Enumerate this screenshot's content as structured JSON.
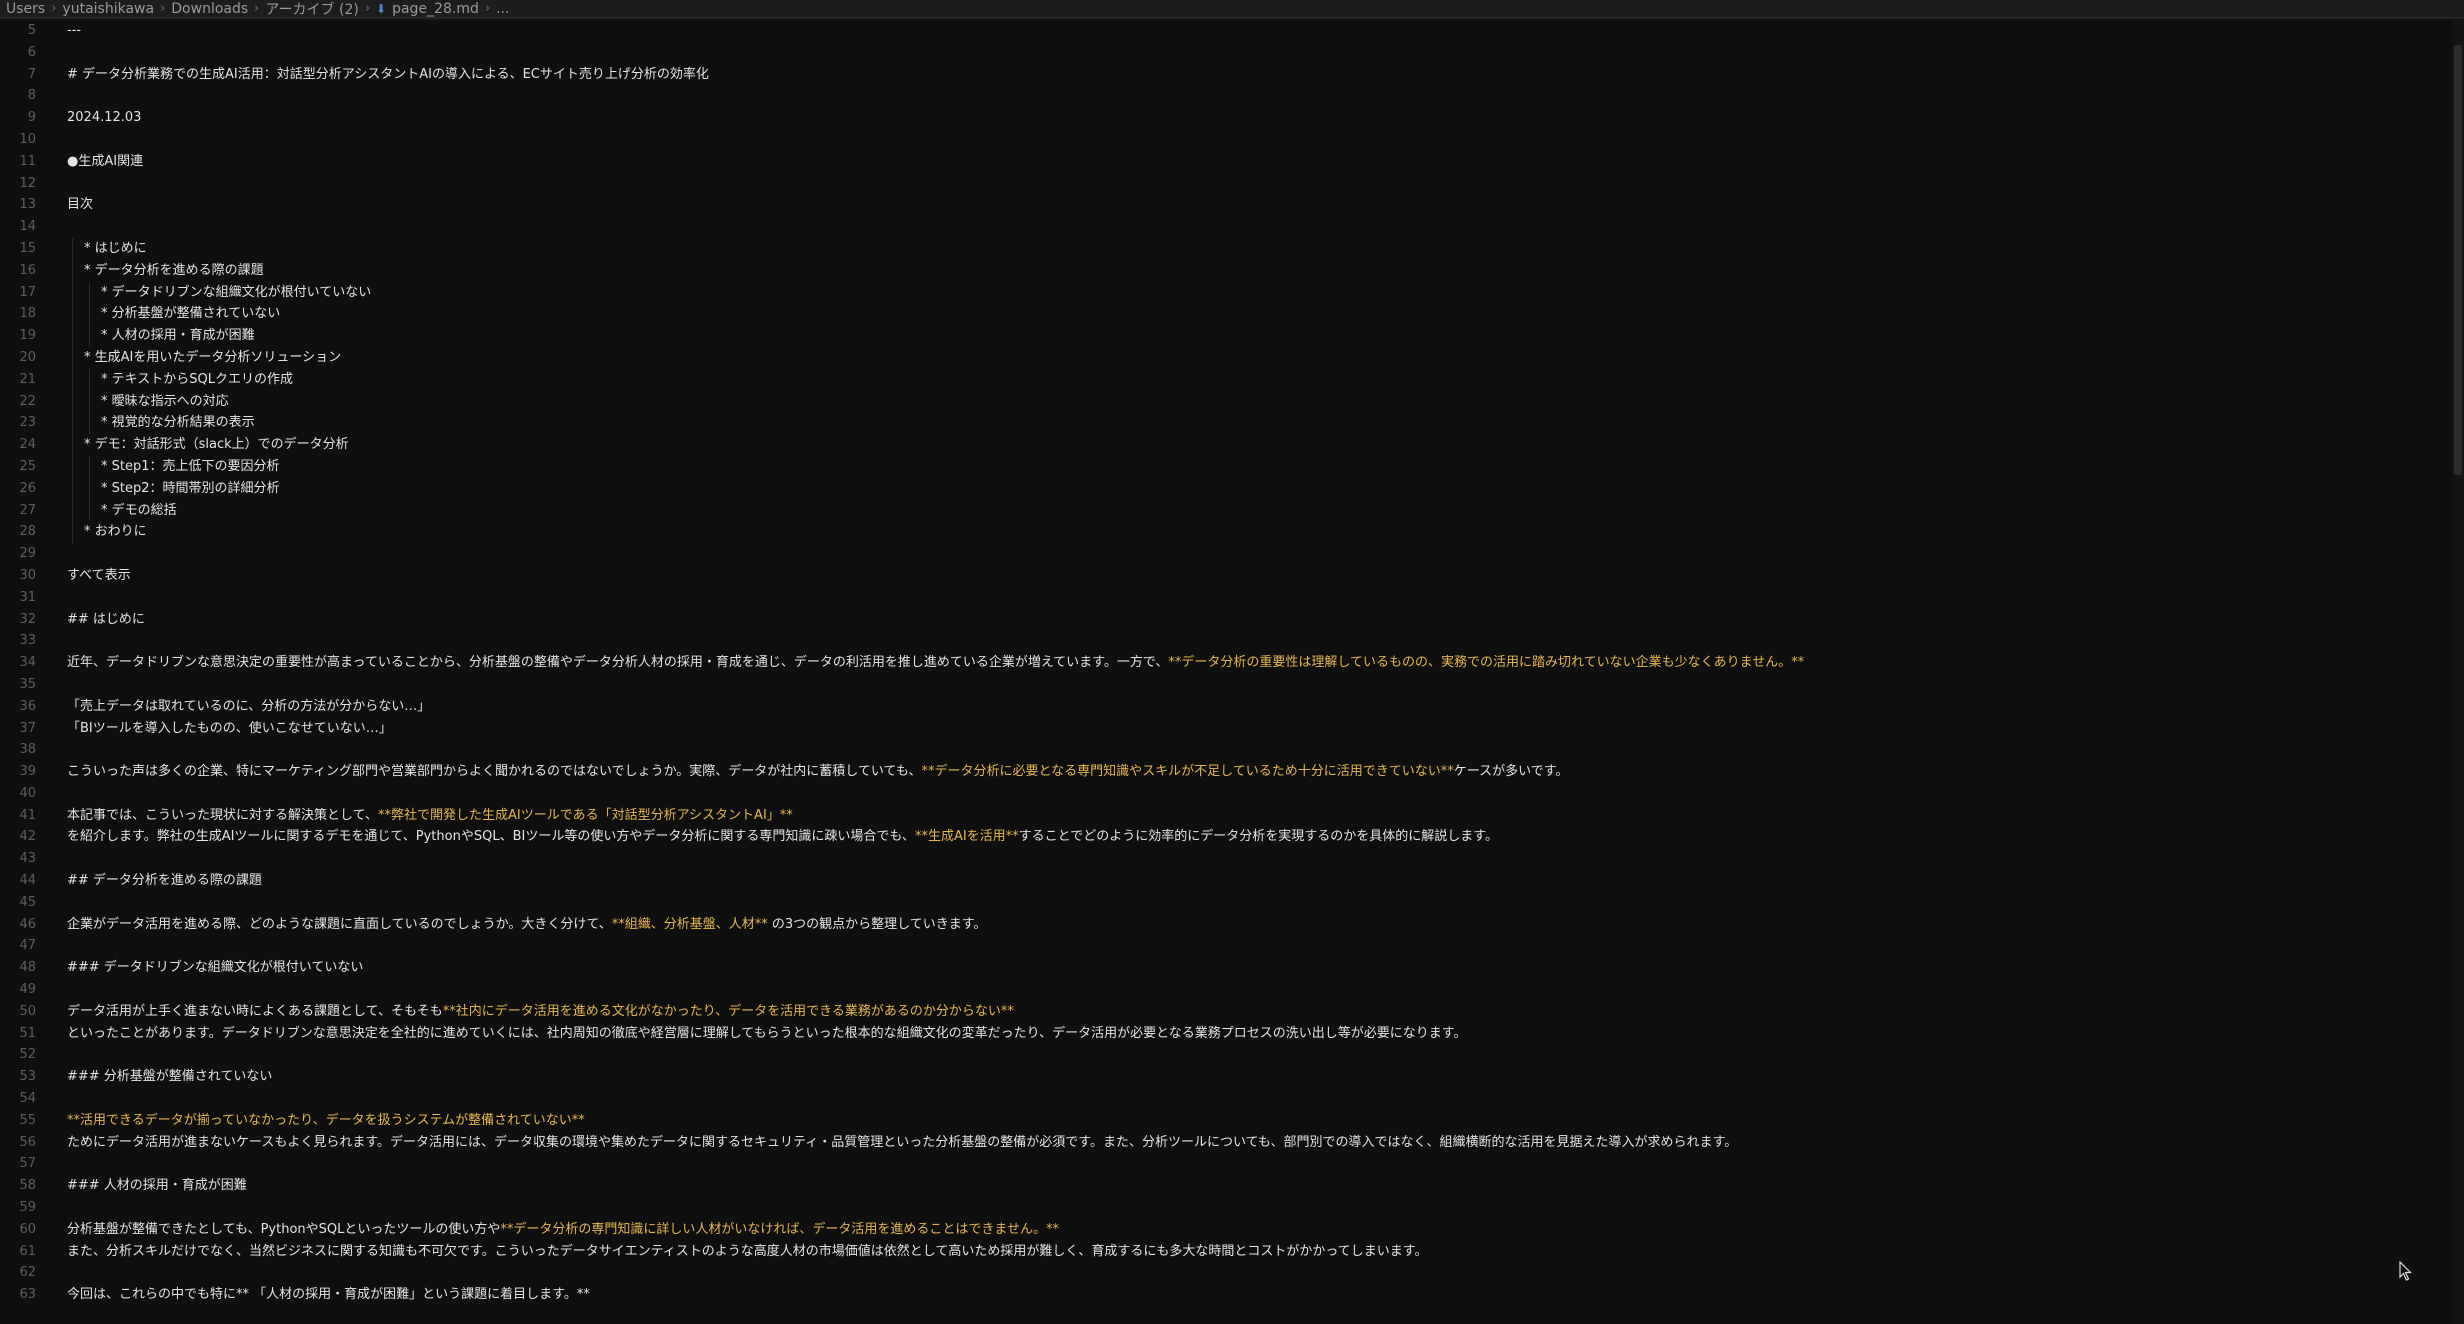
{
  "breadcrumb": {
    "items": [
      "Users",
      "yutaishikawa",
      "Downloads",
      "アーカイブ (2)",
      "page_28.md",
      "..."
    ]
  },
  "editor": {
    "lines": [
      {
        "n": "5",
        "indent": 0,
        "segments": [
          {
            "t": "---",
            "hl": false
          }
        ]
      },
      {
        "n": "6",
        "indent": 0,
        "segments": []
      },
      {
        "n": "7",
        "indent": 0,
        "segments": [
          {
            "t": "# データ分析業務での生成AI活用：対話型分析アシスタントAIの導入による、ECサイト売り上げ分析の効率化",
            "hl": false
          }
        ]
      },
      {
        "n": "8",
        "indent": 0,
        "segments": []
      },
      {
        "n": "9",
        "indent": 0,
        "segments": [
          {
            "t": "2024.12.03",
            "hl": false
          }
        ]
      },
      {
        "n": "10",
        "indent": 0,
        "segments": []
      },
      {
        "n": "11",
        "indent": 0,
        "segments": [
          {
            "t": "●生成AI関連",
            "hl": false
          }
        ]
      },
      {
        "n": "12",
        "indent": 0,
        "segments": []
      },
      {
        "n": "13",
        "indent": 0,
        "segments": [
          {
            "t": "目次",
            "hl": false
          }
        ]
      },
      {
        "n": "14",
        "indent": 0,
        "segments": []
      },
      {
        "n": "15",
        "indent": 1,
        "segments": [
          {
            "t": "* はじめに",
            "hl": false
          }
        ]
      },
      {
        "n": "16",
        "indent": 1,
        "segments": [
          {
            "t": "* データ分析を進める際の課題",
            "hl": false
          }
        ]
      },
      {
        "n": "17",
        "indent": 2,
        "segments": [
          {
            "t": "* データドリブンな組織文化が根付いていない",
            "hl": false
          }
        ]
      },
      {
        "n": "18",
        "indent": 2,
        "segments": [
          {
            "t": "* 分析基盤が整備されていない",
            "hl": false
          }
        ]
      },
      {
        "n": "19",
        "indent": 2,
        "segments": [
          {
            "t": "* 人材の採用・育成が困難",
            "hl": false
          }
        ]
      },
      {
        "n": "20",
        "indent": 1,
        "segments": [
          {
            "t": "* 生成AIを用いたデータ分析ソリューション",
            "hl": false
          }
        ]
      },
      {
        "n": "21",
        "indent": 2,
        "segments": [
          {
            "t": "* テキストからSQLクエリの作成",
            "hl": false
          }
        ]
      },
      {
        "n": "22",
        "indent": 2,
        "segments": [
          {
            "t": "* 曖昧な指示への対応",
            "hl": false
          }
        ]
      },
      {
        "n": "23",
        "indent": 2,
        "segments": [
          {
            "t": "* 視覚的な分析結果の表示",
            "hl": false
          }
        ]
      },
      {
        "n": "24",
        "indent": 1,
        "segments": [
          {
            "t": "* デモ：対話形式（slack上）でのデータ分析",
            "hl": false
          }
        ]
      },
      {
        "n": "25",
        "indent": 2,
        "segments": [
          {
            "t": "* Step1：売上低下の要因分析",
            "hl": false
          }
        ]
      },
      {
        "n": "26",
        "indent": 2,
        "segments": [
          {
            "t": "* Step2：時間帯別の詳細分析",
            "hl": false
          }
        ]
      },
      {
        "n": "27",
        "indent": 2,
        "segments": [
          {
            "t": "* デモの総括",
            "hl": false
          }
        ]
      },
      {
        "n": "28",
        "indent": 1,
        "segments": [
          {
            "t": "* おわりに",
            "hl": false
          }
        ]
      },
      {
        "n": "29",
        "indent": 0,
        "segments": []
      },
      {
        "n": "30",
        "indent": 0,
        "segments": [
          {
            "t": "すべて表示",
            "hl": false
          }
        ]
      },
      {
        "n": "31",
        "indent": 0,
        "segments": []
      },
      {
        "n": "32",
        "indent": 0,
        "segments": [
          {
            "t": "## はじめに",
            "hl": false
          }
        ]
      },
      {
        "n": "33",
        "indent": 0,
        "segments": []
      },
      {
        "n": "34",
        "indent": 0,
        "segments": [
          {
            "t": "近年、データドリブンな意思決定の重要性が高まっていることから、分析基盤の整備やデータ分析人材の採用・育成を通じ、データの利活用を推し進めている企業が増えています。一方で、",
            "hl": false
          },
          {
            "t": "**データ分析の重要性は理解しているものの、実務での活用に踏み切れていない企業も少なくありません。**",
            "hl": true
          }
        ]
      },
      {
        "n": "35",
        "indent": 0,
        "segments": []
      },
      {
        "n": "36",
        "indent": 0,
        "segments": [
          {
            "t": "「売上データは取れているのに、分析の方法が分からない…」",
            "hl": false
          }
        ]
      },
      {
        "n": "37",
        "indent": 0,
        "segments": [
          {
            "t": "「BIツールを導入したものの、使いこなせていない…」",
            "hl": false
          }
        ]
      },
      {
        "n": "38",
        "indent": 0,
        "segments": []
      },
      {
        "n": "39",
        "indent": 0,
        "segments": [
          {
            "t": "こういった声は多くの企業、特にマーケティング部門や営業部門からよく聞かれるのではないでしょうか。実際、データが社内に蓄積していても、",
            "hl": false
          },
          {
            "t": "**データ分析に必要となる専門知識やスキルが不足しているため十分に活用できていない**",
            "hl": true
          },
          {
            "t": "ケースが多いです。",
            "hl": false
          }
        ]
      },
      {
        "n": "40",
        "indent": 0,
        "segments": []
      },
      {
        "n": "41",
        "indent": 0,
        "segments": [
          {
            "t": "本記事では、こういった現状に対する解決策として、",
            "hl": false
          },
          {
            "t": "**弊社で開発した生成AIツールである「対話型分析アシスタントAI」**",
            "hl": true
          }
        ]
      },
      {
        "n": "42",
        "indent": 0,
        "segments": [
          {
            "t": "を紹介します。弊社の生成AIツールに関するデモを通じて、PythonやSQL、BIツール等の使い方やデータ分析に関する専門知識に疎い場合でも、",
            "hl": false
          },
          {
            "t": "**生成AIを活用**",
            "hl": true
          },
          {
            "t": "することでどのように効率的にデータ分析を実現するのかを具体的に解説します。",
            "hl": false
          }
        ]
      },
      {
        "n": "43",
        "indent": 0,
        "segments": []
      },
      {
        "n": "44",
        "indent": 0,
        "segments": [
          {
            "t": "## データ分析を進める際の課題",
            "hl": false
          }
        ]
      },
      {
        "n": "45",
        "indent": 0,
        "segments": []
      },
      {
        "n": "46",
        "indent": 0,
        "segments": [
          {
            "t": "企業がデータ活用を進める際、どのような課題に直面しているのでしょうか。大きく分けて、",
            "hl": false
          },
          {
            "t": "**組織、分析基盤、人材**",
            "hl": true
          },
          {
            "t": " の3つの観点から整理していきます。",
            "hl": false
          }
        ]
      },
      {
        "n": "47",
        "indent": 0,
        "segments": []
      },
      {
        "n": "48",
        "indent": 0,
        "segments": [
          {
            "t": "### データドリブンな組織文化が根付いていない",
            "hl": false
          }
        ]
      },
      {
        "n": "49",
        "indent": 0,
        "segments": []
      },
      {
        "n": "50",
        "indent": 0,
        "segments": [
          {
            "t": "データ活用が上手く進まない時によくある課題として、そもそも",
            "hl": false
          },
          {
            "t": "**社内にデータ活用を進める文化がなかったり、データを活用できる業務があるのか分からない**",
            "hl": true
          }
        ]
      },
      {
        "n": "51",
        "indent": 0,
        "segments": [
          {
            "t": "といったことがあります。データドリブンな意思決定を全社的に進めていくには、社内周知の徹底や経営層に理解してもらうといった根本的な組織文化の変革だったり、データ活用が必要となる業務プロセスの洗い出し等が必要になります。",
            "hl": false
          }
        ]
      },
      {
        "n": "52",
        "indent": 0,
        "segments": []
      },
      {
        "n": "53",
        "indent": 0,
        "segments": [
          {
            "t": "### 分析基盤が整備されていない",
            "hl": false
          }
        ]
      },
      {
        "n": "54",
        "indent": 0,
        "segments": []
      },
      {
        "n": "55",
        "indent": 0,
        "segments": [
          {
            "t": "**活用できるデータが揃っていなかったり、データを扱うシステムが整備されていない**",
            "hl": true
          }
        ]
      },
      {
        "n": "56",
        "indent": 0,
        "segments": [
          {
            "t": "ためにデータ活用が進まないケースもよく見られます。データ活用には、データ収集の環境や集めたデータに関するセキュリティ・品質管理といった分析基盤の整備が必須です。また、分析ツールについても、部門別での導入ではなく、組織横断的な活用を見据えた導入が求められます。",
            "hl": false
          }
        ]
      },
      {
        "n": "57",
        "indent": 0,
        "segments": []
      },
      {
        "n": "58",
        "indent": 0,
        "segments": [
          {
            "t": "### 人材の採用・育成が困難",
            "hl": false
          }
        ]
      },
      {
        "n": "59",
        "indent": 0,
        "segments": []
      },
      {
        "n": "60",
        "indent": 0,
        "segments": [
          {
            "t": "分析基盤が整備できたとしても、PythonやSQLといったツールの使い方や",
            "hl": false
          },
          {
            "t": "**データ分析の専門知識に詳しい人材がいなければ、データ活用を進めることはできません。**",
            "hl": true
          }
        ]
      },
      {
        "n": "61",
        "indent": 0,
        "segments": [
          {
            "t": "また、分析スキルだけでなく、当然ビジネスに関する知識も不可欠です。こういったデータサイエンティストのような高度人材の市場価値は依然として高いため採用が難しく、育成するにも多大な時間とコストがかかってしまいます。",
            "hl": false
          }
        ]
      },
      {
        "n": "62",
        "indent": 0,
        "segments": []
      },
      {
        "n": "63",
        "indent": 0,
        "segments": [
          {
            "t": "今回は、これらの中でも特に** 「人材の採用・育成が困難」という課題に着目します。**",
            "hl": false
          }
        ]
      }
    ]
  },
  "colors": {
    "background": "#0f0f10",
    "text": "#e4e4e4",
    "bold_highlight": "#e7b651",
    "line_number": "#5e5e62"
  },
  "icons": {
    "file": "markdown-file-icon",
    "pointer": "mouse-pointer-icon"
  }
}
